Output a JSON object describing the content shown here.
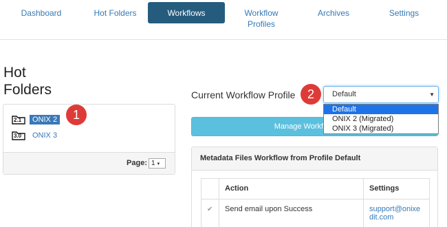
{
  "nav": {
    "items": [
      {
        "label": "Dashboard"
      },
      {
        "label": "Hot Folders"
      },
      {
        "label": "Workflows",
        "active": true
      },
      {
        "label": "Workflow Profiles"
      },
      {
        "label": "Archives"
      },
      {
        "label": "Settings"
      }
    ]
  },
  "hot_folders": {
    "title": "Hot Folders",
    "items": [
      {
        "icon_text": "2.1",
        "label": "ONIX 2",
        "selected": true
      },
      {
        "icon_text": "3.0",
        "label": "ONIX 3",
        "selected": false
      }
    ],
    "page_label": "Page:",
    "page_value": "1"
  },
  "annotations": {
    "badge1": "1",
    "badge2": "2"
  },
  "workflow": {
    "current_profile_label": "Current Workflow Profile",
    "selected_profile": "Default",
    "options": [
      "Default",
      "ONIX 2 (Migrated)",
      "ONIX 3 (Migrated)"
    ],
    "manage_button": "Manage Workflow Profiles",
    "metadata_heading": "Metadata Files Workflow from Profile Default",
    "table": {
      "headers": [
        "",
        "Action",
        "Settings"
      ],
      "rows": [
        {
          "checked": true,
          "action": "Send email upon Success",
          "settings": "support@onixedit.com"
        }
      ]
    }
  },
  "colors": {
    "nav_active": "#255c7e",
    "link": "#3579b6",
    "button_info": "#5bc0de",
    "badge": "#dd3b38",
    "highlight": "#1e73e8"
  }
}
